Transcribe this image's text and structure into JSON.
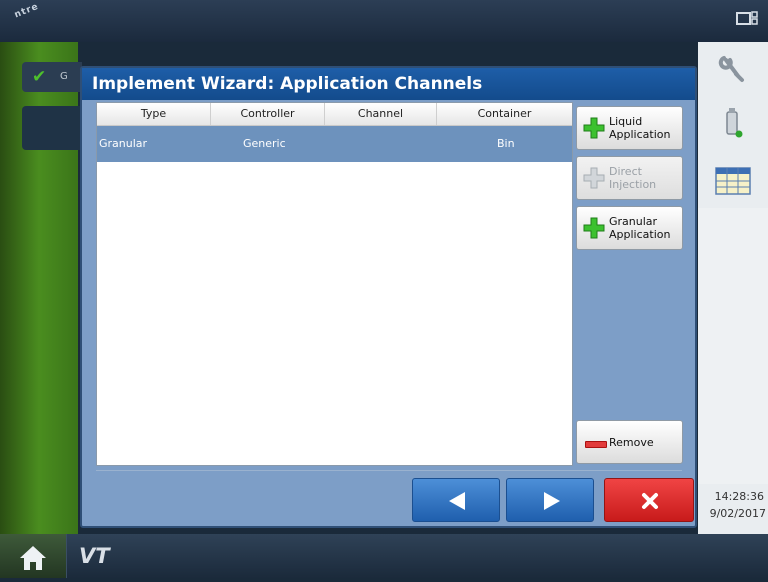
{
  "dialog": {
    "title": "Implement Wizard:  Application Channels"
  },
  "table": {
    "columns": [
      "Type",
      "Controller",
      "Channel",
      "Container"
    ],
    "rows": [
      {
        "type": "Granular",
        "controller": "Generic",
        "channel": "",
        "container": "Bin"
      }
    ]
  },
  "side_buttons": {
    "liquid": {
      "line1": "Liquid",
      "line2": "Application",
      "enabled": true
    },
    "direct": {
      "line1": "Direct",
      "line2": "Injection",
      "enabled": false
    },
    "granular": {
      "line1": "Granular",
      "line2": "Application",
      "enabled": true
    },
    "remove": {
      "label": "Remove"
    }
  },
  "background": {
    "status_label": "G"
  },
  "system": {
    "time": "14:28:36",
    "date": "9/02/2017",
    "logo_text": "ntre"
  },
  "bottom_bar": {
    "vt_label": "VT"
  },
  "icons": {
    "home": "home-icon",
    "vt": "vt-icon",
    "wrench": "wrench-icon",
    "usb": "usb-icon",
    "grid": "grid-icon",
    "speaker": "speaker-icon",
    "display": "display-icon",
    "back": "arrow-left-icon",
    "next": "arrow-right-icon",
    "cancel": "close-icon",
    "add": "plus-icon",
    "remove": "minus-icon"
  },
  "colors": {
    "title_bar": "#1e5ea8",
    "dialog_bg": "#7d9ec7",
    "selected_row": "#6d92bd",
    "add_green": "#3cc12f",
    "nav_blue": "#2f78c8",
    "cancel_red": "#e02b2b"
  }
}
